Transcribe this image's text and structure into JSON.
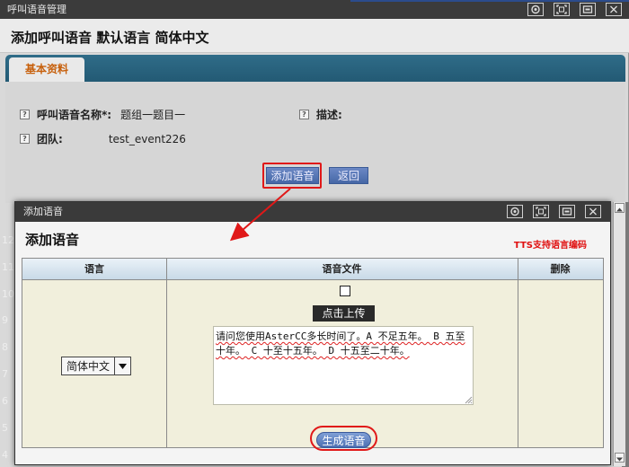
{
  "window": {
    "title": "呼叫语音管理",
    "header_title": "添加呼叫语音 默认语言 简体中文"
  },
  "tabs": [
    {
      "label": "基本资料"
    }
  ],
  "form": {
    "name_label": "呼叫语音名称*:",
    "name_value": "题组一题目一",
    "desc_label": "描述:",
    "team_label": "团队:",
    "team_value": "test_event226",
    "add_button": "添加语音",
    "back_button": "返回"
  },
  "side_numbers": [
    "12",
    "11",
    "10",
    "9",
    "8",
    "7",
    "6",
    "5",
    "4",
    "3"
  ],
  "modal": {
    "titlebar": "添加语音",
    "title": "添加语音",
    "tts_link": "TTS支持语言编码",
    "columns": [
      "语言",
      "语音文件",
      "删除"
    ],
    "language_select": "简体中文",
    "upload_button": "点击上传",
    "tts_text": "请问您使用AsterCC多长时间了。A 不足五年。 B 五至十年。 C 十至十五年。 D 十五至二十年。",
    "generate_button": "生成语音"
  },
  "colors": {
    "highlight_ring": "#e01818",
    "tab_active_text": "#c7600c",
    "tabbar": "#2f6c88",
    "button_blue": "#4d6fb2",
    "link_red": "#e01010"
  },
  "icons": [
    "settings-icon",
    "maximize-icon",
    "minimize-icon",
    "close-icon",
    "help-icon",
    "chevron-down-icon"
  ]
}
